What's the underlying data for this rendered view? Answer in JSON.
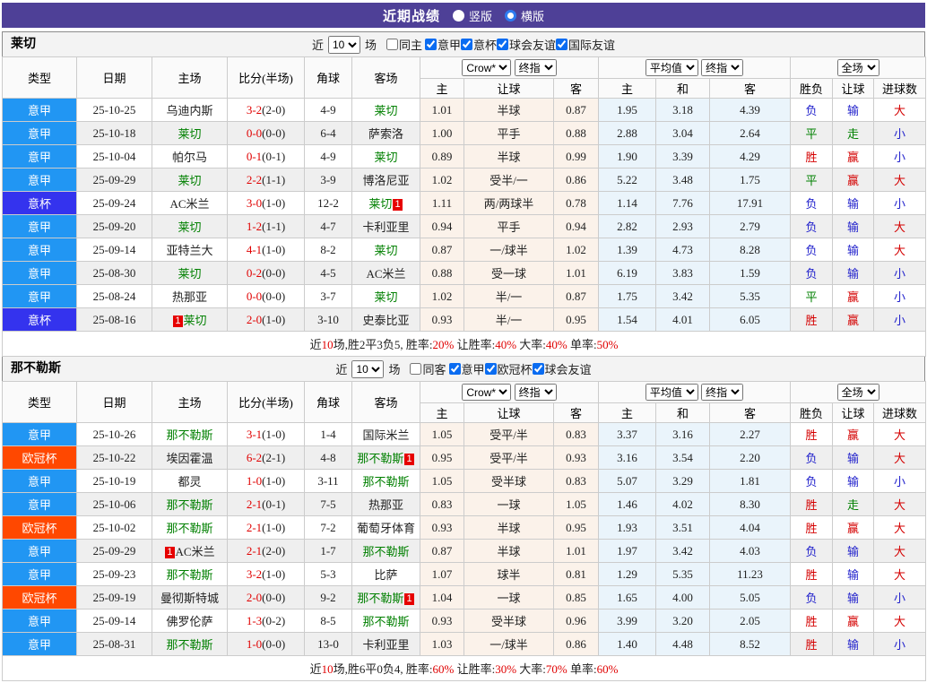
{
  "title_bar": {
    "title": "近期战绩",
    "radios": [
      {
        "label": "竖版",
        "checked": false
      },
      {
        "label": "横版",
        "checked": true
      }
    ]
  },
  "colors": {
    "header_purple": "#4E4097",
    "type_serie_a": "#2196F3",
    "type_coppa_italia": "#3433EE",
    "type_champions_league": "#FF4800",
    "focus_team_green": "#008000",
    "win_red": "#D40000",
    "draw_green": "#008000",
    "lose_blue": "#2222CC",
    "crow_column_bg": "#FBF2EA",
    "avg_column_bg": "#EAF4FB"
  },
  "type_colors": {
    "意甲": "#2196F3",
    "意杯": "#3433EE",
    "欧冠杯": "#FF4800"
  },
  "result_color_map": {
    "胜": "t-red",
    "赢": "t-red",
    "大": "t-red",
    "平": "t-green",
    "走": "t-green",
    "负": "t-blue",
    "输": "t-blue",
    "小": "t-blue"
  },
  "table_headers": {
    "main": [
      "类型",
      "日期",
      "主场",
      "比分(半场)",
      "角球",
      "客场"
    ],
    "sub": [
      "主",
      "让球",
      "客",
      "主",
      "和",
      "客",
      "胜负",
      "让球",
      "进球数"
    ],
    "selects": {
      "crow": "Crow*",
      "final": "终指",
      "avg": "平均值",
      "full": "全场"
    }
  },
  "tables": [
    {
      "team": "莱切",
      "filter": {
        "near_label": "近",
        "count": "10",
        "field_label": "场",
        "same_label": "同主",
        "same_checked": false,
        "comps": [
          "意甲",
          "意杯",
          "球会友谊",
          "国际友谊"
        ]
      },
      "rows": [
        {
          "type": "意甲",
          "date": "25-10-25",
          "home": {
            "name": "乌迪内斯"
          },
          "score": "3-2",
          "half": "(2-0)",
          "corner": "4-9",
          "away": {
            "name": "莱切",
            "focus": true
          },
          "crow": [
            "1.01",
            "半球",
            "0.87"
          ],
          "avg": [
            "1.95",
            "3.18",
            "4.39"
          ],
          "res": [
            "负",
            "输",
            "大"
          ]
        },
        {
          "type": "意甲",
          "date": "25-10-18",
          "home": {
            "name": "莱切",
            "focus": true
          },
          "score": "0-0",
          "half": "(0-0)",
          "corner": "6-4",
          "away": {
            "name": "萨索洛"
          },
          "crow": [
            "1.00",
            "平手",
            "0.88"
          ],
          "avg": [
            "2.88",
            "3.04",
            "2.64"
          ],
          "res": [
            "平",
            "走",
            "小"
          ]
        },
        {
          "type": "意甲",
          "date": "25-10-04",
          "home": {
            "name": "帕尔马"
          },
          "score": "0-1",
          "half": "(0-1)",
          "corner": "4-9",
          "away": {
            "name": "莱切",
            "focus": true
          },
          "crow": [
            "0.89",
            "半球",
            "0.99"
          ],
          "avg": [
            "1.90",
            "3.39",
            "4.29"
          ],
          "res": [
            "胜",
            "赢",
            "小"
          ]
        },
        {
          "type": "意甲",
          "date": "25-09-29",
          "home": {
            "name": "莱切",
            "focus": true
          },
          "score": "2-2",
          "half": "(1-1)",
          "corner": "3-9",
          "away": {
            "name": "博洛尼亚"
          },
          "crow": [
            "1.02",
            "受半/一",
            "0.86"
          ],
          "avg": [
            "5.22",
            "3.48",
            "1.75"
          ],
          "res": [
            "平",
            "赢",
            "大"
          ]
        },
        {
          "type": "意杯",
          "date": "25-09-24",
          "home": {
            "name": "AC米兰"
          },
          "score": "3-0",
          "half": "(1-0)",
          "corner": "12-2",
          "away": {
            "name": "莱切",
            "focus": true,
            "card": "1",
            "card_pos": "after"
          },
          "crow": [
            "1.11",
            "两/两球半",
            "0.78"
          ],
          "avg": [
            "1.14",
            "7.76",
            "17.91"
          ],
          "res": [
            "负",
            "输",
            "小"
          ]
        },
        {
          "type": "意甲",
          "date": "25-09-20",
          "home": {
            "name": "莱切",
            "focus": true
          },
          "score": "1-2",
          "half": "(1-1)",
          "corner": "4-7",
          "away": {
            "name": "卡利亚里"
          },
          "crow": [
            "0.94",
            "平手",
            "0.94"
          ],
          "avg": [
            "2.82",
            "2.93",
            "2.79"
          ],
          "res": [
            "负",
            "输",
            "大"
          ]
        },
        {
          "type": "意甲",
          "date": "25-09-14",
          "home": {
            "name": "亚特兰大"
          },
          "score": "4-1",
          "half": "(1-0)",
          "corner": "8-2",
          "away": {
            "name": "莱切",
            "focus": true
          },
          "crow": [
            "0.87",
            "一/球半",
            "1.02"
          ],
          "avg": [
            "1.39",
            "4.73",
            "8.28"
          ],
          "res": [
            "负",
            "输",
            "大"
          ]
        },
        {
          "type": "意甲",
          "date": "25-08-30",
          "home": {
            "name": "莱切",
            "focus": true
          },
          "score": "0-2",
          "half": "(0-0)",
          "corner": "4-5",
          "away": {
            "name": "AC米兰"
          },
          "crow": [
            "0.88",
            "受一球",
            "1.01"
          ],
          "avg": [
            "6.19",
            "3.83",
            "1.59"
          ],
          "res": [
            "负",
            "输",
            "小"
          ]
        },
        {
          "type": "意甲",
          "date": "25-08-24",
          "home": {
            "name": "热那亚"
          },
          "score": "0-0",
          "half": "(0-0)",
          "corner": "3-7",
          "away": {
            "name": "莱切",
            "focus": true
          },
          "crow": [
            "1.02",
            "半/一",
            "0.87"
          ],
          "avg": [
            "1.75",
            "3.42",
            "5.35"
          ],
          "res": [
            "平",
            "赢",
            "小"
          ]
        },
        {
          "type": "意杯",
          "date": "25-08-16",
          "home": {
            "name": "莱切",
            "focus": true,
            "card": "1",
            "card_pos": "before"
          },
          "score": "2-0",
          "half": "(1-0)",
          "corner": "3-10",
          "away": {
            "name": "史泰比亚"
          },
          "crow": [
            "0.93",
            "半/一",
            "0.95"
          ],
          "avg": [
            "1.54",
            "4.01",
            "6.05"
          ],
          "res": [
            "胜",
            "赢",
            "小"
          ]
        }
      ],
      "summary": [
        {
          "t": "近"
        },
        {
          "t": "10",
          "red": true
        },
        {
          "t": "场,胜2平3负5, 胜率:"
        },
        {
          "t": "20%",
          "red": true
        },
        {
          "t": " 让胜率:"
        },
        {
          "t": "40%",
          "red": true
        },
        {
          "t": " 大率:"
        },
        {
          "t": "40%",
          "red": true
        },
        {
          "t": " 单率:"
        },
        {
          "t": "50%",
          "red": true
        }
      ]
    },
    {
      "team": "那不勒斯",
      "filter": {
        "near_label": "近",
        "count": "10",
        "field_label": "场",
        "same_label": "同客",
        "same_checked": false,
        "comps": [
          "意甲",
          "欧冠杯",
          "球会友谊"
        ]
      },
      "rows": [
        {
          "type": "意甲",
          "date": "25-10-26",
          "home": {
            "name": "那不勒斯",
            "focus": true
          },
          "score": "3-1",
          "half": "(1-0)",
          "corner": "1-4",
          "away": {
            "name": "国际米兰"
          },
          "crow": [
            "1.05",
            "受平/半",
            "0.83"
          ],
          "avg": [
            "3.37",
            "3.16",
            "2.27"
          ],
          "res": [
            "胜",
            "赢",
            "大"
          ]
        },
        {
          "type": "欧冠杯",
          "date": "25-10-22",
          "home": {
            "name": "埃因霍温"
          },
          "score": "6-2",
          "half": "(2-1)",
          "corner": "4-8",
          "away": {
            "name": "那不勒斯",
            "focus": true,
            "card": "1",
            "card_pos": "after"
          },
          "crow": [
            "0.95",
            "受平/半",
            "0.93"
          ],
          "avg": [
            "3.16",
            "3.54",
            "2.20"
          ],
          "res": [
            "负",
            "输",
            "大"
          ]
        },
        {
          "type": "意甲",
          "date": "25-10-19",
          "home": {
            "name": "都灵"
          },
          "score": "1-0",
          "half": "(1-0)",
          "corner": "3-11",
          "away": {
            "name": "那不勒斯",
            "focus": true
          },
          "crow": [
            "1.05",
            "受半球",
            "0.83"
          ],
          "avg": [
            "5.07",
            "3.29",
            "1.81"
          ],
          "res": [
            "负",
            "输",
            "小"
          ]
        },
        {
          "type": "意甲",
          "date": "25-10-06",
          "home": {
            "name": "那不勒斯",
            "focus": true
          },
          "score": "2-1",
          "half": "(0-1)",
          "corner": "7-5",
          "away": {
            "name": "热那亚"
          },
          "crow": [
            "0.83",
            "一球",
            "1.05"
          ],
          "avg": [
            "1.46",
            "4.02",
            "8.30"
          ],
          "res": [
            "胜",
            "走",
            "大"
          ]
        },
        {
          "type": "欧冠杯",
          "date": "25-10-02",
          "home": {
            "name": "那不勒斯",
            "focus": true
          },
          "score": "2-1",
          "half": "(1-0)",
          "corner": "7-2",
          "away": {
            "name": "葡萄牙体育"
          },
          "crow": [
            "0.93",
            "半球",
            "0.95"
          ],
          "avg": [
            "1.93",
            "3.51",
            "4.04"
          ],
          "res": [
            "胜",
            "赢",
            "大"
          ]
        },
        {
          "type": "意甲",
          "date": "25-09-29",
          "home": {
            "name": "AC米兰",
            "card": "1",
            "card_pos": "before"
          },
          "score": "2-1",
          "half": "(2-0)",
          "corner": "1-7",
          "away": {
            "name": "那不勒斯",
            "focus": true
          },
          "crow": [
            "0.87",
            "半球",
            "1.01"
          ],
          "avg": [
            "1.97",
            "3.42",
            "4.03"
          ],
          "res": [
            "负",
            "输",
            "大"
          ]
        },
        {
          "type": "意甲",
          "date": "25-09-23",
          "home": {
            "name": "那不勒斯",
            "focus": true
          },
          "score": "3-2",
          "half": "(1-0)",
          "corner": "5-3",
          "away": {
            "name": "比萨"
          },
          "crow": [
            "1.07",
            "球半",
            "0.81"
          ],
          "avg": [
            "1.29",
            "5.35",
            "11.23"
          ],
          "res": [
            "胜",
            "输",
            "大"
          ]
        },
        {
          "type": "欧冠杯",
          "date": "25-09-19",
          "home": {
            "name": "曼彻斯特城"
          },
          "score": "2-0",
          "half": "(0-0)",
          "corner": "9-2",
          "away": {
            "name": "那不勒斯",
            "focus": true,
            "card": "1",
            "card_pos": "after"
          },
          "crow": [
            "1.04",
            "一球",
            "0.85"
          ],
          "avg": [
            "1.65",
            "4.00",
            "5.05"
          ],
          "res": [
            "负",
            "输",
            "小"
          ]
        },
        {
          "type": "意甲",
          "date": "25-09-14",
          "home": {
            "name": "佛罗伦萨"
          },
          "score": "1-3",
          "half": "(0-2)",
          "corner": "8-5",
          "away": {
            "name": "那不勒斯",
            "focus": true
          },
          "crow": [
            "0.93",
            "受半球",
            "0.96"
          ],
          "avg": [
            "3.99",
            "3.20",
            "2.05"
          ],
          "res": [
            "胜",
            "赢",
            "大"
          ]
        },
        {
          "type": "意甲",
          "date": "25-08-31",
          "home": {
            "name": "那不勒斯",
            "focus": true
          },
          "score": "1-0",
          "half": "(0-0)",
          "corner": "13-0",
          "away": {
            "name": "卡利亚里"
          },
          "crow": [
            "1.03",
            "一/球半",
            "0.86"
          ],
          "avg": [
            "1.40",
            "4.48",
            "8.52"
          ],
          "res": [
            "胜",
            "输",
            "小"
          ]
        }
      ],
      "summary": [
        {
          "t": "近"
        },
        {
          "t": "10",
          "red": true
        },
        {
          "t": "场,胜6平0负4, 胜率:"
        },
        {
          "t": "60%",
          "red": true
        },
        {
          "t": " 让胜率:"
        },
        {
          "t": "30%",
          "red": true
        },
        {
          "t": " 大率:"
        },
        {
          "t": "70%",
          "red": true
        },
        {
          "t": " 单率:"
        },
        {
          "t": "60%",
          "red": true
        }
      ]
    }
  ]
}
